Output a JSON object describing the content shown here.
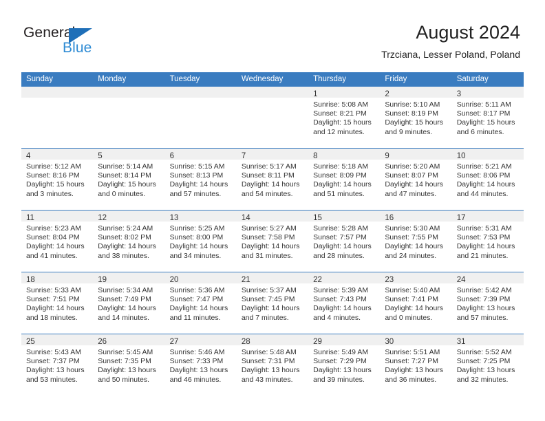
{
  "brand": {
    "word_one": "General",
    "word_two": "Blue",
    "triangle_color": "#1f6fb8",
    "blue_color": "#2e8bd4"
  },
  "header": {
    "title": "August 2024",
    "subtitle": "Trzciana, Lesser Poland, Poland",
    "accent_color": "#3a7cc0"
  },
  "weekdays": [
    "Sunday",
    "Monday",
    "Tuesday",
    "Wednesday",
    "Thursday",
    "Friday",
    "Saturday"
  ],
  "labels": {
    "sunrise": "Sunrise:",
    "sunset": "Sunset:",
    "daylight": "Daylight:"
  },
  "weeks": [
    [
      {
        "day": "",
        "empty": true
      },
      {
        "day": "",
        "empty": true
      },
      {
        "day": "",
        "empty": true
      },
      {
        "day": "",
        "empty": true
      },
      {
        "day": "1",
        "sunrise": "Sunrise: 5:08 AM",
        "sunset": "Sunset: 8:21 PM",
        "daylight_1": "Daylight: 15 hours",
        "daylight_2": "and 12 minutes."
      },
      {
        "day": "2",
        "sunrise": "Sunrise: 5:10 AM",
        "sunset": "Sunset: 8:19 PM",
        "daylight_1": "Daylight: 15 hours",
        "daylight_2": "and 9 minutes."
      },
      {
        "day": "3",
        "sunrise": "Sunrise: 5:11 AM",
        "sunset": "Sunset: 8:17 PM",
        "daylight_1": "Daylight: 15 hours",
        "daylight_2": "and 6 minutes."
      }
    ],
    [
      {
        "day": "4",
        "sunrise": "Sunrise: 5:12 AM",
        "sunset": "Sunset: 8:16 PM",
        "daylight_1": "Daylight: 15 hours",
        "daylight_2": "and 3 minutes."
      },
      {
        "day": "5",
        "sunrise": "Sunrise: 5:14 AM",
        "sunset": "Sunset: 8:14 PM",
        "daylight_1": "Daylight: 15 hours",
        "daylight_2": "and 0 minutes."
      },
      {
        "day": "6",
        "sunrise": "Sunrise: 5:15 AM",
        "sunset": "Sunset: 8:13 PM",
        "daylight_1": "Daylight: 14 hours",
        "daylight_2": "and 57 minutes."
      },
      {
        "day": "7",
        "sunrise": "Sunrise: 5:17 AM",
        "sunset": "Sunset: 8:11 PM",
        "daylight_1": "Daylight: 14 hours",
        "daylight_2": "and 54 minutes."
      },
      {
        "day": "8",
        "sunrise": "Sunrise: 5:18 AM",
        "sunset": "Sunset: 8:09 PM",
        "daylight_1": "Daylight: 14 hours",
        "daylight_2": "and 51 minutes."
      },
      {
        "day": "9",
        "sunrise": "Sunrise: 5:20 AM",
        "sunset": "Sunset: 8:07 PM",
        "daylight_1": "Daylight: 14 hours",
        "daylight_2": "and 47 minutes."
      },
      {
        "day": "10",
        "sunrise": "Sunrise: 5:21 AM",
        "sunset": "Sunset: 8:06 PM",
        "daylight_1": "Daylight: 14 hours",
        "daylight_2": "and 44 minutes."
      }
    ],
    [
      {
        "day": "11",
        "sunrise": "Sunrise: 5:23 AM",
        "sunset": "Sunset: 8:04 PM",
        "daylight_1": "Daylight: 14 hours",
        "daylight_2": "and 41 minutes."
      },
      {
        "day": "12",
        "sunrise": "Sunrise: 5:24 AM",
        "sunset": "Sunset: 8:02 PM",
        "daylight_1": "Daylight: 14 hours",
        "daylight_2": "and 38 minutes."
      },
      {
        "day": "13",
        "sunrise": "Sunrise: 5:25 AM",
        "sunset": "Sunset: 8:00 PM",
        "daylight_1": "Daylight: 14 hours",
        "daylight_2": "and 34 minutes."
      },
      {
        "day": "14",
        "sunrise": "Sunrise: 5:27 AM",
        "sunset": "Sunset: 7:58 PM",
        "daylight_1": "Daylight: 14 hours",
        "daylight_2": "and 31 minutes."
      },
      {
        "day": "15",
        "sunrise": "Sunrise: 5:28 AM",
        "sunset": "Sunset: 7:57 PM",
        "daylight_1": "Daylight: 14 hours",
        "daylight_2": "and 28 minutes."
      },
      {
        "day": "16",
        "sunrise": "Sunrise: 5:30 AM",
        "sunset": "Sunset: 7:55 PM",
        "daylight_1": "Daylight: 14 hours",
        "daylight_2": "and 24 minutes."
      },
      {
        "day": "17",
        "sunrise": "Sunrise: 5:31 AM",
        "sunset": "Sunset: 7:53 PM",
        "daylight_1": "Daylight: 14 hours",
        "daylight_2": "and 21 minutes."
      }
    ],
    [
      {
        "day": "18",
        "sunrise": "Sunrise: 5:33 AM",
        "sunset": "Sunset: 7:51 PM",
        "daylight_1": "Daylight: 14 hours",
        "daylight_2": "and 18 minutes."
      },
      {
        "day": "19",
        "sunrise": "Sunrise: 5:34 AM",
        "sunset": "Sunset: 7:49 PM",
        "daylight_1": "Daylight: 14 hours",
        "daylight_2": "and 14 minutes."
      },
      {
        "day": "20",
        "sunrise": "Sunrise: 5:36 AM",
        "sunset": "Sunset: 7:47 PM",
        "daylight_1": "Daylight: 14 hours",
        "daylight_2": "and 11 minutes."
      },
      {
        "day": "21",
        "sunrise": "Sunrise: 5:37 AM",
        "sunset": "Sunset: 7:45 PM",
        "daylight_1": "Daylight: 14 hours",
        "daylight_2": "and 7 minutes."
      },
      {
        "day": "22",
        "sunrise": "Sunrise: 5:39 AM",
        "sunset": "Sunset: 7:43 PM",
        "daylight_1": "Daylight: 14 hours",
        "daylight_2": "and 4 minutes."
      },
      {
        "day": "23",
        "sunrise": "Sunrise: 5:40 AM",
        "sunset": "Sunset: 7:41 PM",
        "daylight_1": "Daylight: 14 hours",
        "daylight_2": "and 0 minutes."
      },
      {
        "day": "24",
        "sunrise": "Sunrise: 5:42 AM",
        "sunset": "Sunset: 7:39 PM",
        "daylight_1": "Daylight: 13 hours",
        "daylight_2": "and 57 minutes."
      }
    ],
    [
      {
        "day": "25",
        "sunrise": "Sunrise: 5:43 AM",
        "sunset": "Sunset: 7:37 PM",
        "daylight_1": "Daylight: 13 hours",
        "daylight_2": "and 53 minutes."
      },
      {
        "day": "26",
        "sunrise": "Sunrise: 5:45 AM",
        "sunset": "Sunset: 7:35 PM",
        "daylight_1": "Daylight: 13 hours",
        "daylight_2": "and 50 minutes."
      },
      {
        "day": "27",
        "sunrise": "Sunrise: 5:46 AM",
        "sunset": "Sunset: 7:33 PM",
        "daylight_1": "Daylight: 13 hours",
        "daylight_2": "and 46 minutes."
      },
      {
        "day": "28",
        "sunrise": "Sunrise: 5:48 AM",
        "sunset": "Sunset: 7:31 PM",
        "daylight_1": "Daylight: 13 hours",
        "daylight_2": "and 43 minutes."
      },
      {
        "day": "29",
        "sunrise": "Sunrise: 5:49 AM",
        "sunset": "Sunset: 7:29 PM",
        "daylight_1": "Daylight: 13 hours",
        "daylight_2": "and 39 minutes."
      },
      {
        "day": "30",
        "sunrise": "Sunrise: 5:51 AM",
        "sunset": "Sunset: 7:27 PM",
        "daylight_1": "Daylight: 13 hours",
        "daylight_2": "and 36 minutes."
      },
      {
        "day": "31",
        "sunrise": "Sunrise: 5:52 AM",
        "sunset": "Sunset: 7:25 PM",
        "daylight_1": "Daylight: 13 hours",
        "daylight_2": "and 32 minutes."
      }
    ]
  ]
}
